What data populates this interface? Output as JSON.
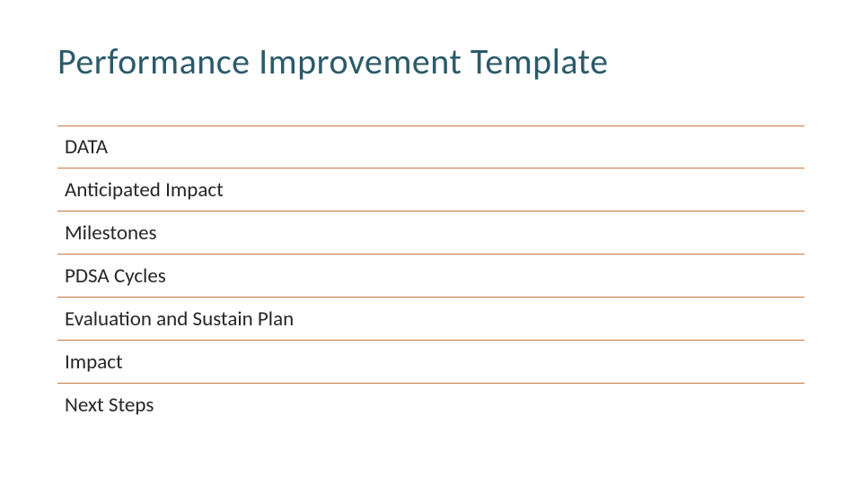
{
  "title": "Performance Improvement Template",
  "rows": [
    "DATA",
    "Anticipated Impact",
    "Milestones",
    "PDSA Cycles",
    "Evaluation and Sustain Plan",
    "Impact",
    "Next Steps"
  ],
  "colors": {
    "title": "#2b5a6a",
    "rule": "#c9783e",
    "text": "#262626"
  }
}
